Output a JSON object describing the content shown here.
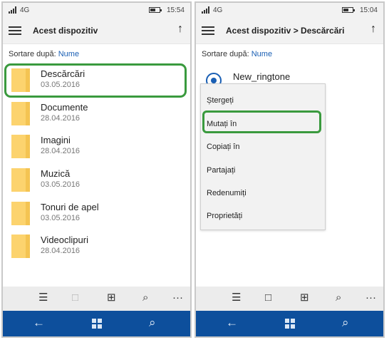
{
  "left": {
    "status": {
      "network": "4G",
      "time": "15:54"
    },
    "title": "Acest dispozitiv",
    "sort": {
      "label": "Sortare după:",
      "value": "Nume"
    },
    "folders": [
      {
        "name": "Descărcări",
        "date": "03.05.2016"
      },
      {
        "name": "Documente",
        "date": "28.04.2016"
      },
      {
        "name": "Imagini",
        "date": "28.04.2016"
      },
      {
        "name": "Muzică",
        "date": "03.05.2016"
      },
      {
        "name": "Tonuri de apel",
        "date": "03.05.2016"
      },
      {
        "name": "Videoclipuri",
        "date": "28.04.2016"
      }
    ]
  },
  "right": {
    "status": {
      "network": "4G",
      "time": "15:04"
    },
    "title": "Acest dispozitiv > Descărcări",
    "sort": {
      "label": "Sortare după:",
      "value": "Nume"
    },
    "file": "New_ringtone",
    "menu": [
      "Ștergeți",
      "Mutați în",
      "Copiați în",
      "Partajați",
      "Redenumiți",
      "Proprietăți"
    ]
  },
  "icons": {
    "up": "↑",
    "select": "☰",
    "new": "□",
    "view": "⊞",
    "search": "⌕",
    "more": "···",
    "back": "←",
    "windows": "windows-icon"
  },
  "colors": {
    "highlight": "#3a9a3e",
    "navbar": "#0d4f9c",
    "accent": "#1a5fb4",
    "folder": "#fcd36e"
  }
}
